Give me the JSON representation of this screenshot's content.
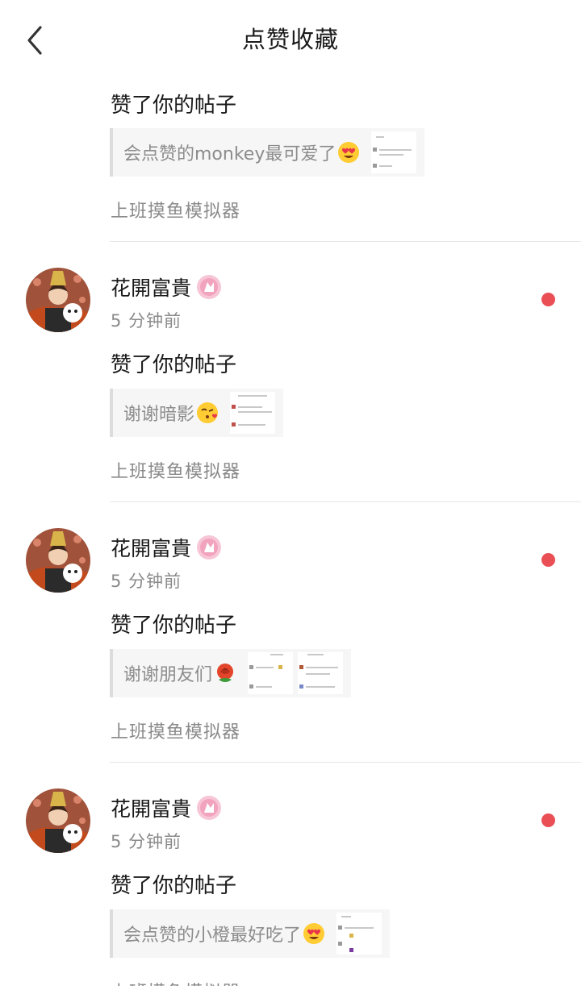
{
  "header": {
    "title": "点赞收藏",
    "back_icon": "chevron-left-icon"
  },
  "colors": {
    "unread_dot": "#ea4f55",
    "badge": "#f2a3bd",
    "muted_text": "#8a8a8a"
  },
  "notifications": [
    {
      "user_name": "",
      "time": "",
      "action": "赞了你的帖子",
      "post_excerpt": "会点赞的monkey最可爱了",
      "emoji": "heart-eyes-emoji",
      "topic": "上班摸鱼模拟器",
      "unread": false
    },
    {
      "user_name": "花開富貴",
      "time": "5 分钟前",
      "action": "赞了你的帖子",
      "post_excerpt": "谢谢暗影",
      "emoji": "kissing-heart-emoji",
      "topic": "上班摸鱼模拟器",
      "unread": true
    },
    {
      "user_name": "花開富貴",
      "time": "5 分钟前",
      "action": "赞了你的帖子",
      "post_excerpt": "谢谢朋友们",
      "emoji": "rose-emoji",
      "topic": "上班摸鱼模拟器",
      "unread": true
    },
    {
      "user_name": "花開富貴",
      "time": "5 分钟前",
      "action": "赞了你的帖子",
      "post_excerpt": "会点赞的小橙最好吃了",
      "emoji": "heart-eyes-emoji",
      "topic": "上班摸鱼模拟器",
      "unread": true
    }
  ]
}
